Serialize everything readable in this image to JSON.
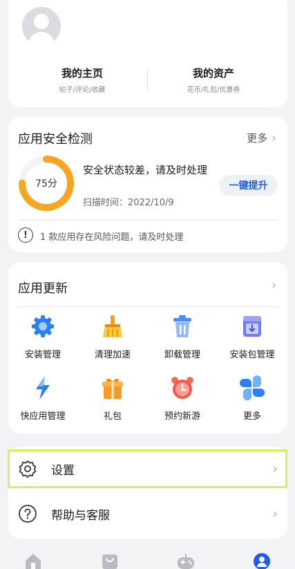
{
  "profile": {
    "home_title": "我的主页",
    "home_sub": "帖子/评论/收藏",
    "assets_title": "我的资产",
    "assets_sub": "花币/礼包/优惠券"
  },
  "security": {
    "title": "应用安全检测",
    "more_label": "更多",
    "score": "75分",
    "score_value": 75,
    "status_text": "安全状态较差，请及时处理",
    "scan_time": "扫描时间：2022/10/9",
    "boost_button": "一键提升",
    "warning_text": "1 款应用存在风险问题，请及时处理",
    "accent_color": "#f5a623"
  },
  "updates": {
    "title": "应用更新",
    "items": [
      {
        "label": "安装管理",
        "icon": "gear-icon"
      },
      {
        "label": "清理加速",
        "icon": "broom-icon"
      },
      {
        "label": "卸载管理",
        "icon": "trash-icon"
      },
      {
        "label": "安装包管理",
        "icon": "package-icon"
      },
      {
        "label": "快应用管理",
        "icon": "lightning-icon"
      },
      {
        "label": "礼包",
        "icon": "gift-icon"
      },
      {
        "label": "预约新游",
        "icon": "alarm-clock-icon"
      },
      {
        "label": "更多",
        "icon": "grid-more-icon"
      }
    ]
  },
  "menu": {
    "settings_label": "设置",
    "help_label": "帮助与客服"
  },
  "colors": {
    "highlight": "#d4f05a",
    "link_blue": "#1e5ee6"
  }
}
